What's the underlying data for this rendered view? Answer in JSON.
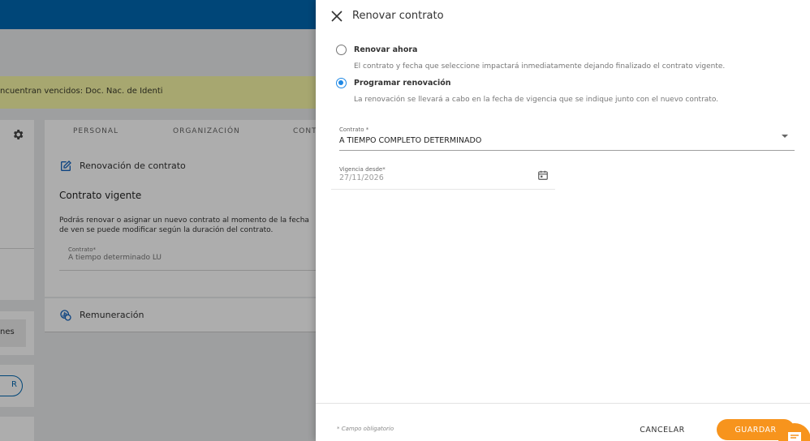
{
  "background": {
    "warning_text": "ncuentran vencidos: Doc. Nac. de Identi",
    "left_inner_text": "nes",
    "pill_text": "R",
    "tabs": [
      "PERSONAL",
      "ORGANIZACIÓN",
      "CONT"
    ],
    "renovacion_title": "Renovación de contrato",
    "vigente_title": "Contrato vigente",
    "description": "Podrás renovar o asignar un nuevo contrato al momento de la fecha de ven se puede modificar según la duración del contrato.",
    "contrato_label": "Contrato*",
    "contrato_value": "A tiempo determinado LU",
    "remuneracion_title": "Remuneración"
  },
  "dialog": {
    "title": "Renovar contrato",
    "options": [
      {
        "label": "Renovar ahora",
        "description": "El contrato y fecha que seleccione impactará inmediatamente dejando finalizado el contrato vigente.",
        "checked": false
      },
      {
        "label": "Programar renovación",
        "description": "La renovación se llevará a cabo en la fecha de vigencia que se indique junto con el nuevo contrato.",
        "checked": true
      }
    ],
    "contrato_field": {
      "label": "Contrato *",
      "value": "A TIEMPO COMPLETO DETERMINADO"
    },
    "vigencia_field": {
      "label": "Vigencia desde*",
      "value": "27/11/2026"
    },
    "required_note": "* Campo obligatorio",
    "cancel_label": "CANCELAR",
    "save_label": "GUARDAR"
  },
  "colors": {
    "topbar": "#0067b1",
    "accent": "#1e88e5",
    "primary_action": "#f7941d",
    "warning_bg": "#f6f7a6"
  },
  "icons": [
    "close-icon",
    "calendar-icon",
    "gear-icon",
    "edit-icon",
    "remuneration-icon",
    "chat-icon"
  ]
}
